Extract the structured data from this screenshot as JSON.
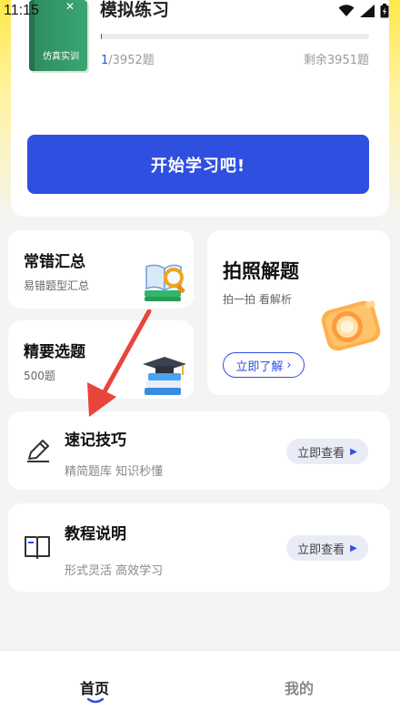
{
  "status_bar": {
    "time": "11:15"
  },
  "practice": {
    "title": "模拟练习",
    "book_label": "仿真实训",
    "done": "1",
    "total": "/3952题",
    "progress_fraction": 0.0003,
    "remaining": "剩余3951题",
    "start_button": "开始学习吧!"
  },
  "mistakes": {
    "title": "常错汇总",
    "subtitle": "易错题型汇总"
  },
  "photo": {
    "title": "拍照解题",
    "subtitle": "拍一拍 看解析",
    "button": "立即了解"
  },
  "selected": {
    "title": "精要选题",
    "subtitle": "500题"
  },
  "tips": {
    "title": "速记技巧",
    "subtitle": "精简题库 知识秒懂",
    "button": "立即查看"
  },
  "tutorial": {
    "title": "教程说明",
    "subtitle": "形式灵活 高效学习",
    "button": "立即查看"
  },
  "tabbar": {
    "home": "首页",
    "mine": "我的"
  },
  "colors": {
    "accent": "#2f4fe0",
    "arrow": "#e8453c",
    "header_bg": "#ffe84a"
  }
}
